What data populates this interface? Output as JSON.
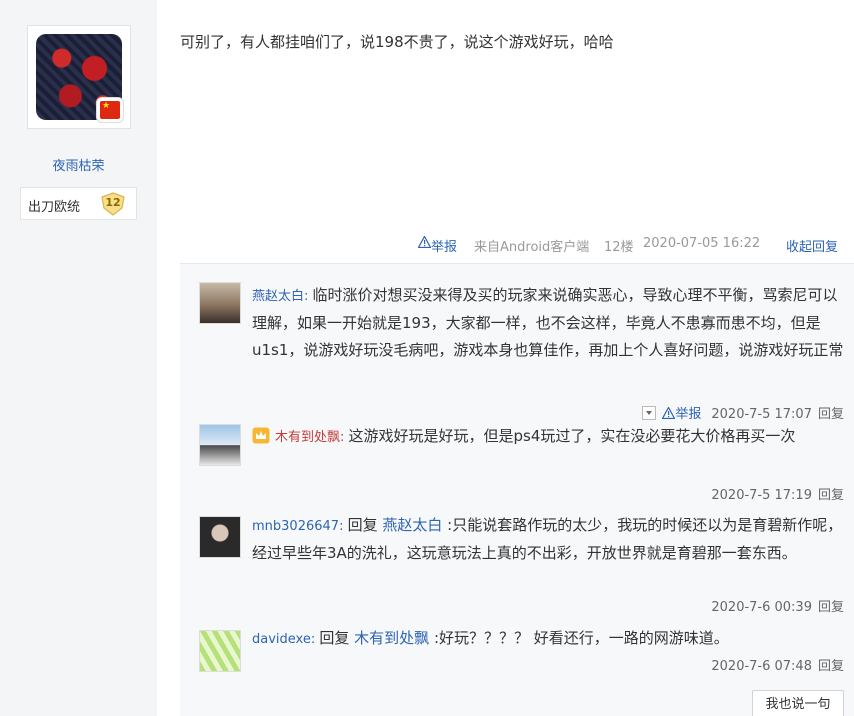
{
  "user": {
    "name": "夜雨枯荣",
    "badge_label": "出刀欧统",
    "badge_level": "12"
  },
  "post": {
    "text": "可别了，有人都挂咱们了，说198不贵了，说这个游戏好玩，哈哈",
    "report_label": "举报",
    "source": "来自Android客户端",
    "floor": "12楼",
    "time": "2020-07-05 16:22",
    "collapse_label": "收起回复"
  },
  "replies": [
    {
      "name": "燕赵太白",
      "text": "临时涨价对想买没来得及买的玩家来说确实恶心，导致心理不平衡，骂索尼可以理解，如果一开始就是193，大家都一样，也不会这样，毕竟人不患寡而患不均，但是u1s1，说游戏好玩没毛病吧，游戏本身也算佳作，再加上个人喜好问题，说游戏好玩正常",
      "report_label": "举报",
      "time": "2020-7-5 17:07",
      "reply_label": "回复"
    },
    {
      "name": "木有到处飘",
      "text": "这游戏好玩是好玩，但是ps4玩过了，实在没必要花大价格再买一次",
      "time": "2020-7-5 17:19",
      "reply_label": "回复"
    },
    {
      "name": "mnb3026647",
      "reply_word": "回复",
      "at": "燕赵太白",
      "text": ":只能说套路作玩的太少，我玩的时候还以为是育碧新作呢，经过早些年3A的洗礼，这玩意玩法上真的不出彩，开放世界就是育碧那一套东西。",
      "time": "2020-7-6 00:39",
      "reply_label": "回复"
    },
    {
      "name": "davidexe",
      "reply_word": "回复",
      "at": "木有到处飘",
      "text": ":好玩？？？？ 好看还行，一路的网游味道。",
      "time": "2020-7-6 07:48",
      "reply_label": "回复"
    }
  ],
  "say_button": "我也说一句",
  "colors": {
    "link": "#2d64b3",
    "vip_name": "#c83a3a",
    "left_bg": "#f4f5f7",
    "reply_bg": "#f7f8fa"
  }
}
